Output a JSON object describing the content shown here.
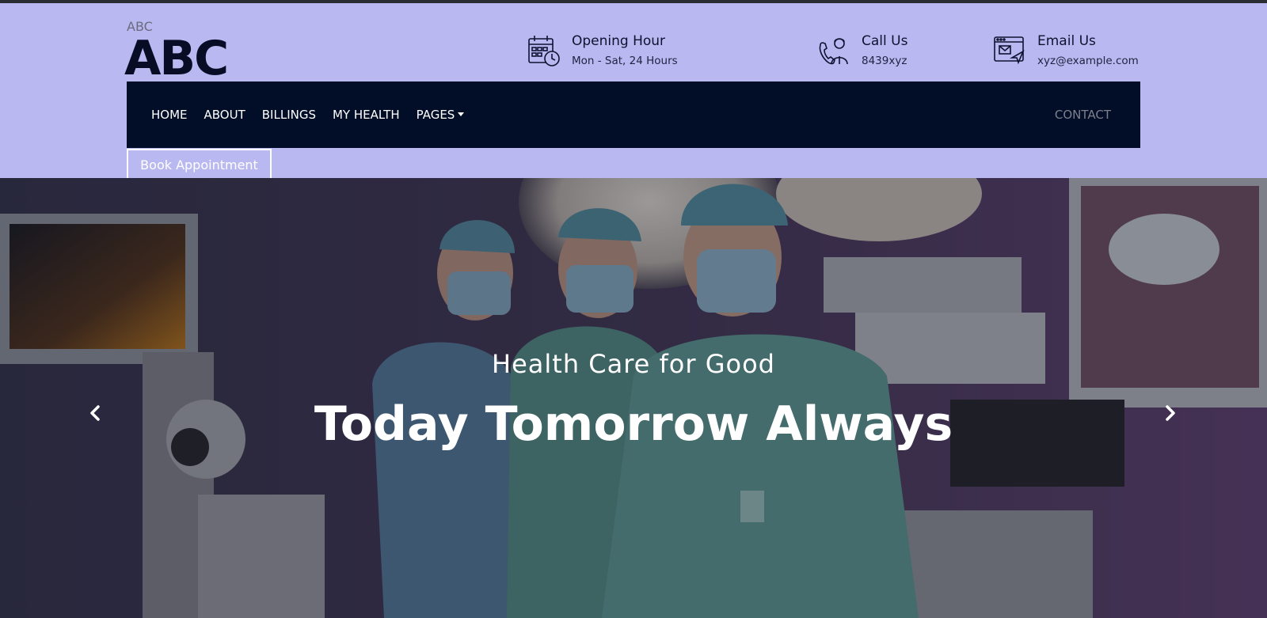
{
  "brand": {
    "small": "ABC",
    "big": "ABC"
  },
  "info": {
    "opening": {
      "icon": "calendar-clock-icon",
      "title": "Opening Hour",
      "detail": "Mon - Sat, 24 Hours"
    },
    "call": {
      "icon": "doctor-phone-icon",
      "title": "Call Us",
      "detail": "8439xyz"
    },
    "email": {
      "icon": "email-window-icon",
      "title": "Email Us",
      "detail": "xyz@example.com"
    }
  },
  "nav": {
    "items": [
      {
        "label": "HOME"
      },
      {
        "label": "ABOUT"
      },
      {
        "label": "BILLINGS"
      },
      {
        "label": "MY HEALTH"
      },
      {
        "label": "PAGES"
      }
    ],
    "contact": "CONTACT"
  },
  "book_button": "Book Appointment",
  "hero": {
    "subtitle": "Health Care for Good",
    "title": "Today Tomorrow Always",
    "prev_icon": "chevron-left-icon",
    "next_icon": "chevron-right-icon"
  },
  "colors": {
    "header_bg": "#b9b8f0",
    "navbar_bg": "#020d28",
    "brand_text": "#070d25",
    "contact_text": "#7d808c"
  }
}
